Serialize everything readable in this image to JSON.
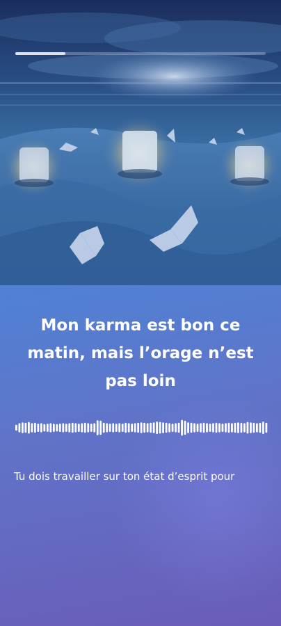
{
  "player": {
    "progress_fraction": 0.2,
    "title": "Mon karma est bon ce matin, mais l’orage n’est pas loin",
    "caption": "Tu dois travailler sur ton état d’esprit pour",
    "waveform_levels": [
      0.35,
      0.55,
      0.65,
      0.6,
      0.7,
      0.55,
      0.6,
      0.5,
      0.55,
      0.45,
      0.5,
      0.55,
      0.5,
      0.45,
      0.5,
      0.55,
      0.5,
      0.55,
      0.6,
      0.55,
      0.5,
      0.55,
      0.6,
      0.55,
      0.5,
      0.55,
      0.9,
      0.85,
      0.6,
      0.55,
      0.5,
      0.55,
      0.5,
      0.55,
      0.5,
      0.6,
      0.55,
      0.5,
      0.55,
      0.6,
      0.65,
      0.6,
      0.55,
      0.6,
      0.65,
      0.75,
      0.7,
      0.65,
      0.6,
      0.55,
      0.5,
      0.55,
      0.6,
      0.95,
      0.85,
      0.65,
      0.6,
      0.55,
      0.5,
      0.55,
      0.6,
      0.55,
      0.5,
      0.55,
      0.6,
      0.55,
      0.5,
      0.55,
      0.6,
      0.55,
      0.6,
      0.65,
      0.6,
      0.55,
      0.7,
      0.65,
      0.6,
      0.55,
      0.6,
      0.75,
      0.6
    ]
  },
  "colors": {
    "background_top": "#3f86d3",
    "background_bottom": "#6a5cb8",
    "text": "#ffffff"
  },
  "icons": {
    "hero": "candles-butterflies-beach-illustration"
  }
}
